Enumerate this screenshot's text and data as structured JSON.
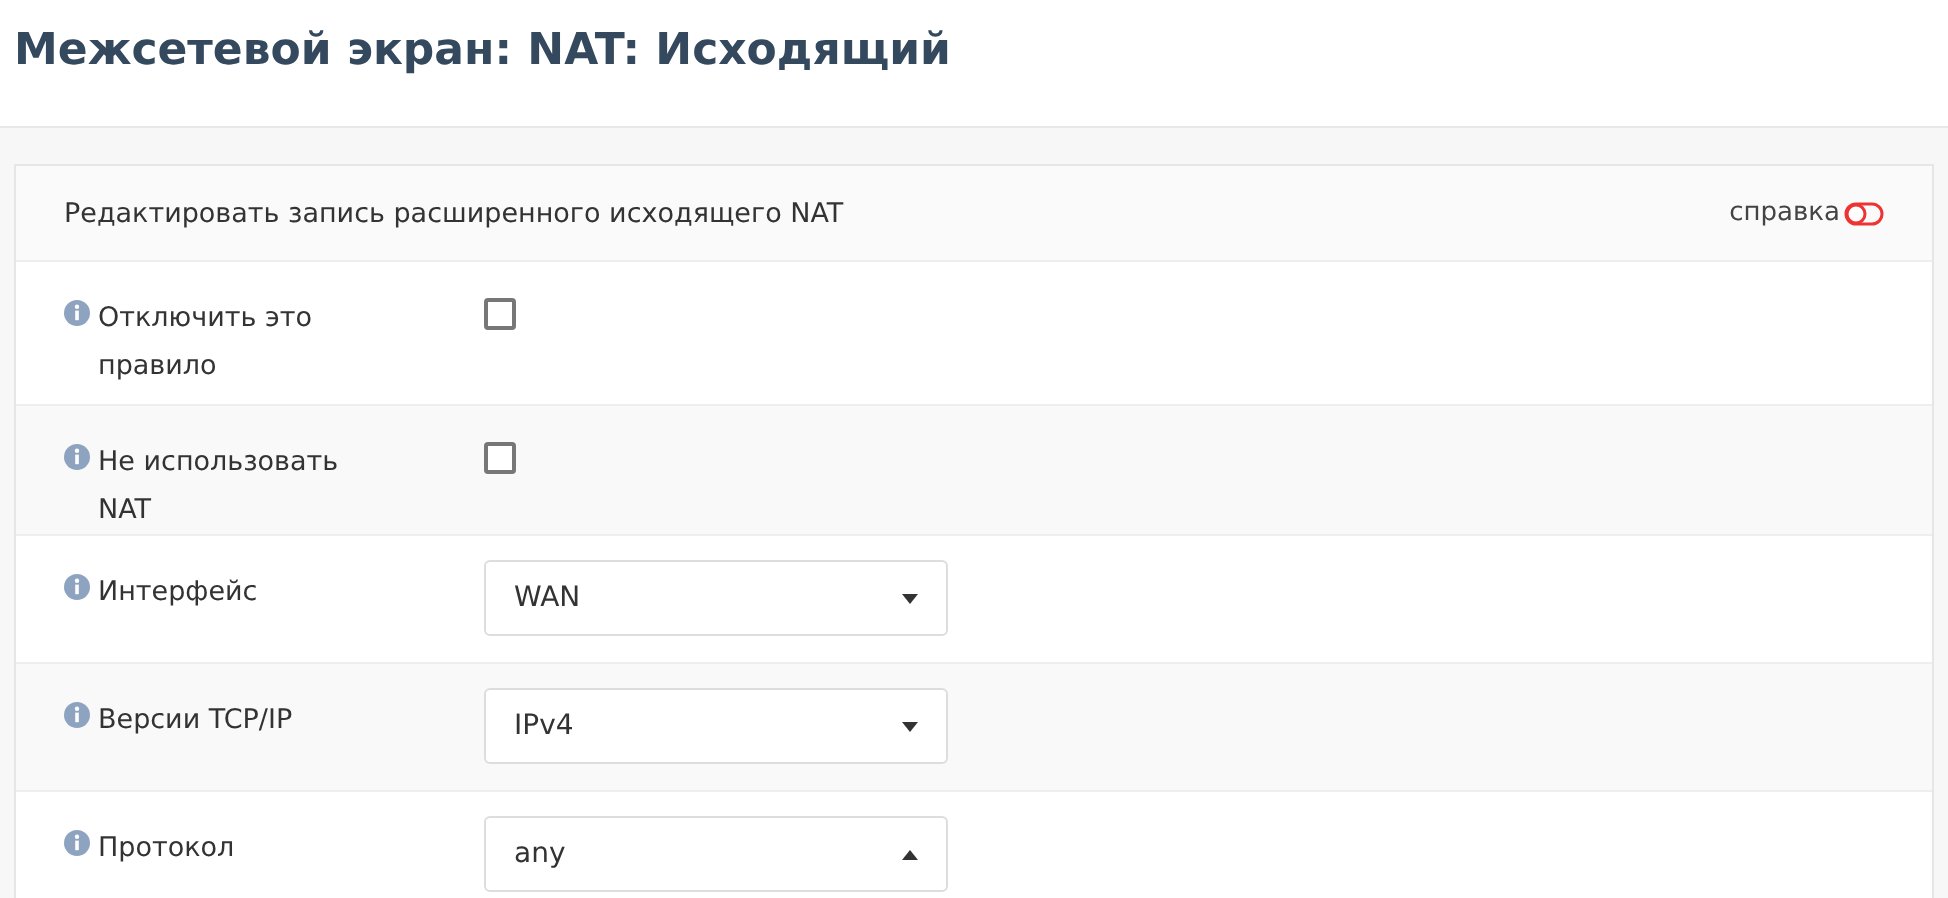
{
  "page_title": "Межсетевой экран: NAT: Исходящий",
  "panel": {
    "title": "Редактировать запись расширенного исходящего NAT",
    "help": {
      "label": "справка",
      "on": false
    }
  },
  "rows": [
    {
      "kind": "checkbox",
      "label": "Отключить это правило",
      "checked": false
    },
    {
      "kind": "checkbox",
      "label": "Не использовать NAT",
      "checked": false
    },
    {
      "kind": "select",
      "label": "Интерфейс",
      "value": "WAN",
      "open": false
    },
    {
      "kind": "select",
      "label": "Версии TCP/IP",
      "value": "IPv4",
      "open": false
    },
    {
      "kind": "select",
      "label": "Протокол",
      "value": "any",
      "open": true
    }
  ]
}
